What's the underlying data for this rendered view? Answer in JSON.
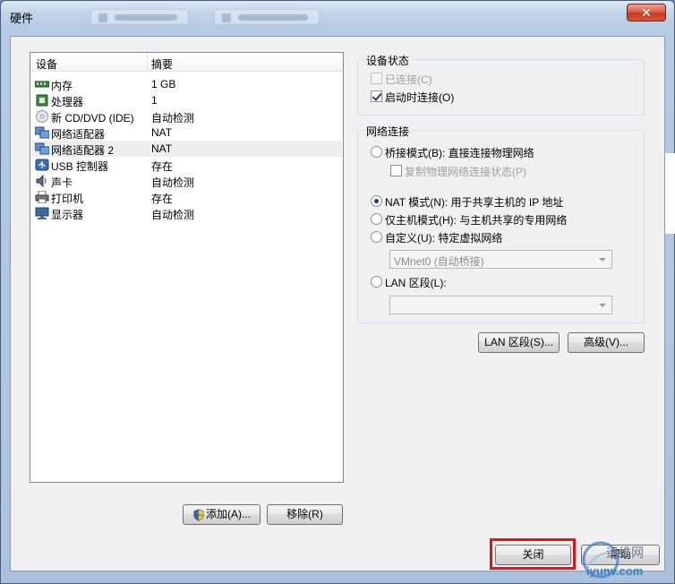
{
  "window": {
    "title": "硬件",
    "close_glyph": "✕"
  },
  "device_list": {
    "columns": {
      "device": "设备",
      "summary": "摘要"
    },
    "items": [
      {
        "name": "内存",
        "summary": "1 GB",
        "icon": "memory-icon"
      },
      {
        "name": "处理器",
        "summary": "1",
        "icon": "processor-icon"
      },
      {
        "name": "新 CD/DVD (IDE)",
        "summary": "自动检测",
        "icon": "cd-dvd-icon"
      },
      {
        "name": "网络适配器",
        "summary": "NAT",
        "icon": "network-adapter-icon"
      },
      {
        "name": "网络适配器 2",
        "summary": "NAT",
        "icon": "network-adapter-icon",
        "selected": true
      },
      {
        "name": "USB 控制器",
        "summary": "存在",
        "icon": "usb-icon"
      },
      {
        "name": "声卡",
        "summary": "自动检测",
        "icon": "sound-card-icon"
      },
      {
        "name": "打印机",
        "summary": "存在",
        "icon": "printer-icon"
      },
      {
        "name": "显示器",
        "summary": "自动检测",
        "icon": "display-icon"
      }
    ],
    "add_button": "添加(A)...",
    "remove_button": "移除(R)"
  },
  "device_status": {
    "title": "设备状态",
    "connected": {
      "label": "已连接(C)",
      "checked": false,
      "disabled": true
    },
    "connect_at_power_on": {
      "label": "启动时连接(O)",
      "checked": true
    }
  },
  "network_connection": {
    "title": "网络连接",
    "bridged": "桥接模式(B): 直接连接物理网络",
    "replicate": "复制物理网络连接状态(P)",
    "nat": "NAT 模式(N): 用于共享主机的 IP 地址",
    "host_only": "仅主机模式(H): 与主机共享的专用网络",
    "custom": "自定义(U): 特定虚拟网络",
    "custom_value": "VMnet0 (自动桥接)",
    "lan_segment": "LAN 区段(L):",
    "lan_segment_value": "",
    "selected": "nat"
  },
  "buttons": {
    "lan_segments": "LAN 区段(S)...",
    "advanced": "高级(V)...",
    "close": "关闭",
    "help": "帮助"
  },
  "watermark": {
    "cn": "运维网",
    "url": "iyunv.com"
  },
  "accent": {
    "highlight": "#e2141a",
    "selection": "#eeeeee"
  }
}
